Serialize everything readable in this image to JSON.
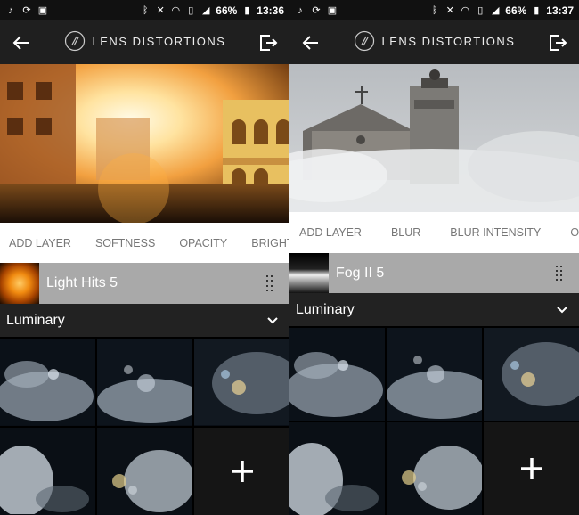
{
  "screens": [
    {
      "status": {
        "battery": "66%",
        "time": "13:36"
      },
      "app_title": "LENS DISTORTIONS",
      "tabs": [
        "ADD LAYER",
        "SOFTNESS",
        "OPACITY",
        "BRIGHTNESS"
      ],
      "layer": {
        "name": "Light Hits 5"
      },
      "category": "Luminary",
      "add_label": "+"
    },
    {
      "status": {
        "battery": "66%",
        "time": "13:37"
      },
      "app_title": "LENS DISTORTIONS",
      "tabs": [
        "ADD LAYER",
        "BLUR",
        "BLUR INTENSITY",
        "OPACITY"
      ],
      "layer": {
        "name": "Fog II 5"
      },
      "category": "Luminary",
      "add_label": "+"
    }
  ],
  "icons": {
    "back": "arrow-left-icon",
    "exit": "exit-icon",
    "logo": "lens-logo-icon",
    "drag": "drag-handle-icon",
    "chevron": "chevron-down-icon",
    "add": "plus-icon"
  },
  "colors": {
    "appbar": "#1f1f1f",
    "tabs_bg": "#ffffff",
    "tab_text": "#777777",
    "layer_row": "#a9a9a9",
    "category_bar": "#222222"
  }
}
